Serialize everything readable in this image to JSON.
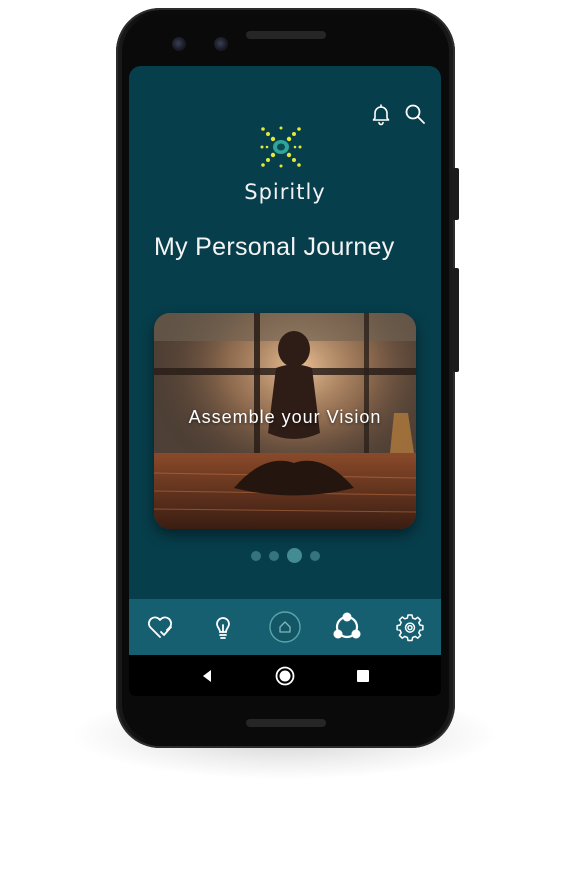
{
  "app": {
    "brand_name": "Spiritly",
    "page_title": "My Personal Journey"
  },
  "header": {
    "icons": [
      "bell-icon",
      "search-icon"
    ]
  },
  "carousel": {
    "current_card_label": "Assemble your Vision",
    "dot_count": 4,
    "active_index": 2
  },
  "bottom_nav": {
    "items": [
      "heart-check-icon",
      "lightbulb-icon",
      "home-icon",
      "share-network-icon",
      "gear-icon"
    ],
    "active_item": "home-icon"
  },
  "system_nav": {
    "items": [
      "back-icon",
      "home-circle-icon",
      "recents-icon"
    ]
  },
  "colors": {
    "screen_bg": "#073e4b",
    "bottom_nav_bg": "#155f71",
    "logo_accent": "#e4e837"
  }
}
